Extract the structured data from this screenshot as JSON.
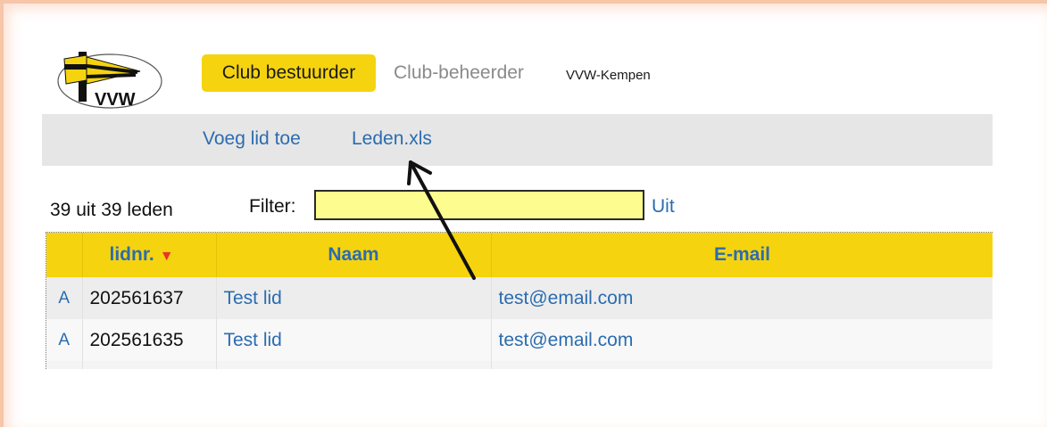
{
  "header": {
    "logo_text": "VVW",
    "nav": [
      {
        "label": "Club bestuurder",
        "active": true
      },
      {
        "label": "Club-beheerder",
        "active": false
      },
      {
        "label": "VVW-Kempen",
        "active": false
      }
    ]
  },
  "actions": {
    "add_member": "Voeg lid toe",
    "export_xls": "Leden.xls"
  },
  "filter": {
    "count_text": "39 uit 39 leden",
    "label": "Filter:",
    "value": "",
    "placeholder": "",
    "off_label": "Uit"
  },
  "table": {
    "columns": [
      "",
      "lidnr.",
      "Naam",
      "E-mail"
    ],
    "sort_indicator": "▼",
    "rows": [
      {
        "flag": "A",
        "id": "202561637",
        "name": "Test lid",
        "email": "test@email.com"
      },
      {
        "flag": "A",
        "id": "202561635",
        "name": "Test lid",
        "email": "test@email.com"
      }
    ]
  },
  "colors": {
    "accent_yellow": "#f5d40f",
    "link_blue": "#2b6cb0",
    "filter_bg": "#fdfd8f",
    "sort_red": "#e8332a",
    "frame_orange": "#f6c6a8"
  },
  "icons": {
    "logo": "vvw-flag-logo-icon",
    "sort": "sort-down-icon",
    "annotation": "annotation-arrow-icon"
  }
}
